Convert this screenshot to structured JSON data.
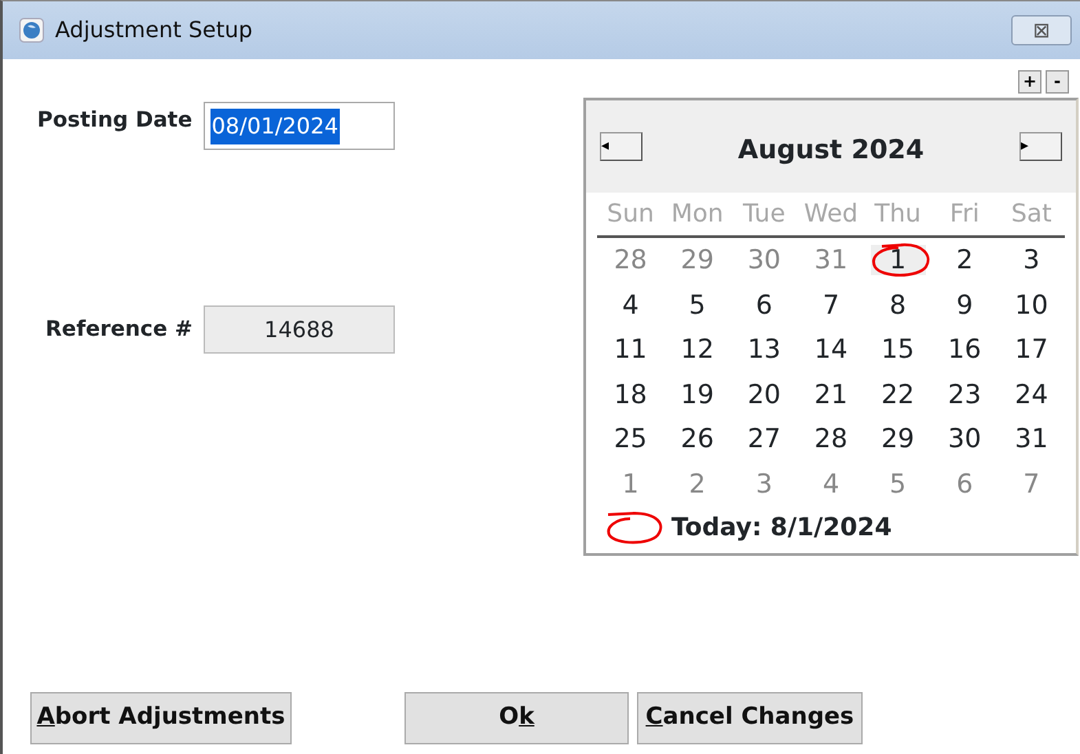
{
  "window": {
    "title": "Adjustment Setup",
    "close": "⊠"
  },
  "zoom_buttons": [
    "+",
    "-"
  ],
  "posting_date": {
    "label": "Posting Date",
    "value": "08/01/2024",
    "text_selected": true
  },
  "reference": {
    "label": "Reference #",
    "value": "14688",
    "disabled": true
  },
  "calendar": {
    "prev": "◂",
    "next": "▸",
    "month": "August 2024",
    "weekdays": [
      "Sun",
      "Mon",
      "Tue",
      "Wed",
      "Thu",
      "Fri",
      "Sat"
    ],
    "weeks": [
      [
        {
          "day": "28",
          "other_month": true,
          "today": false
        },
        {
          "day": "29",
          "other_month": true,
          "today": false
        },
        {
          "day": "30",
          "other_month": true,
          "today": false
        },
        {
          "day": "31",
          "other_month": true,
          "today": false
        },
        {
          "day": "1",
          "other_month": false,
          "today": true
        },
        {
          "day": "2",
          "other_month": false,
          "today": false
        },
        {
          "day": "3",
          "other_month": false,
          "today": false
        }
      ],
      [
        {
          "day": "4",
          "other_month": false,
          "today": false
        },
        {
          "day": "5",
          "other_month": false,
          "today": false
        },
        {
          "day": "6",
          "other_month": false,
          "today": false
        },
        {
          "day": "7",
          "other_month": false,
          "today": false
        },
        {
          "day": "8",
          "other_month": false,
          "today": false
        },
        {
          "day": "9",
          "other_month": false,
          "today": false
        },
        {
          "day": "10",
          "other_month": false,
          "today": false
        }
      ],
      [
        {
          "day": "11",
          "other_month": false,
          "today": false
        },
        {
          "day": "12",
          "other_month": false,
          "today": false
        },
        {
          "day": "13",
          "other_month": false,
          "today": false
        },
        {
          "day": "14",
          "other_month": false,
          "today": false
        },
        {
          "day": "15",
          "other_month": false,
          "today": false
        },
        {
          "day": "16",
          "other_month": false,
          "today": false
        },
        {
          "day": "17",
          "other_month": false,
          "today": false
        }
      ],
      [
        {
          "day": "18",
          "other_month": false,
          "today": false
        },
        {
          "day": "19",
          "other_month": false,
          "today": false
        },
        {
          "day": "20",
          "other_month": false,
          "today": false
        },
        {
          "day": "21",
          "other_month": false,
          "today": false
        },
        {
          "day": "22",
          "other_month": false,
          "today": false
        },
        {
          "day": "23",
          "other_month": false,
          "today": false
        },
        {
          "day": "24",
          "other_month": false,
          "today": false
        }
      ],
      [
        {
          "day": "25",
          "other_month": false,
          "today": false
        },
        {
          "day": "26",
          "other_month": false,
          "today": false
        },
        {
          "day": "27",
          "other_month": false,
          "today": false
        },
        {
          "day": "28",
          "other_month": false,
          "today": false
        },
        {
          "day": "29",
          "other_month": false,
          "today": false
        },
        {
          "day": "30",
          "other_month": false,
          "today": false
        },
        {
          "day": "31",
          "other_month": false,
          "today": false
        }
      ],
      [
        {
          "day": "1",
          "other_month": true,
          "today": false
        },
        {
          "day": "2",
          "other_month": true,
          "today": false
        },
        {
          "day": "3",
          "other_month": true,
          "today": false
        },
        {
          "day": "4",
          "other_month": true,
          "today": false
        },
        {
          "day": "5",
          "other_month": true,
          "today": false
        },
        {
          "day": "6",
          "other_month": true,
          "today": false
        },
        {
          "day": "7",
          "other_month": true,
          "today": false
        }
      ]
    ],
    "today_label": "Today: 8/1/2024"
  },
  "buttons": [
    {
      "key": "A",
      "after": "bort Adjustments",
      "kind": "abort"
    },
    {
      "before": "O",
      "key": "k",
      "kind": "ok"
    },
    {
      "key": "C",
      "after": "ancel Changes",
      "kind": "cancel"
    }
  ]
}
